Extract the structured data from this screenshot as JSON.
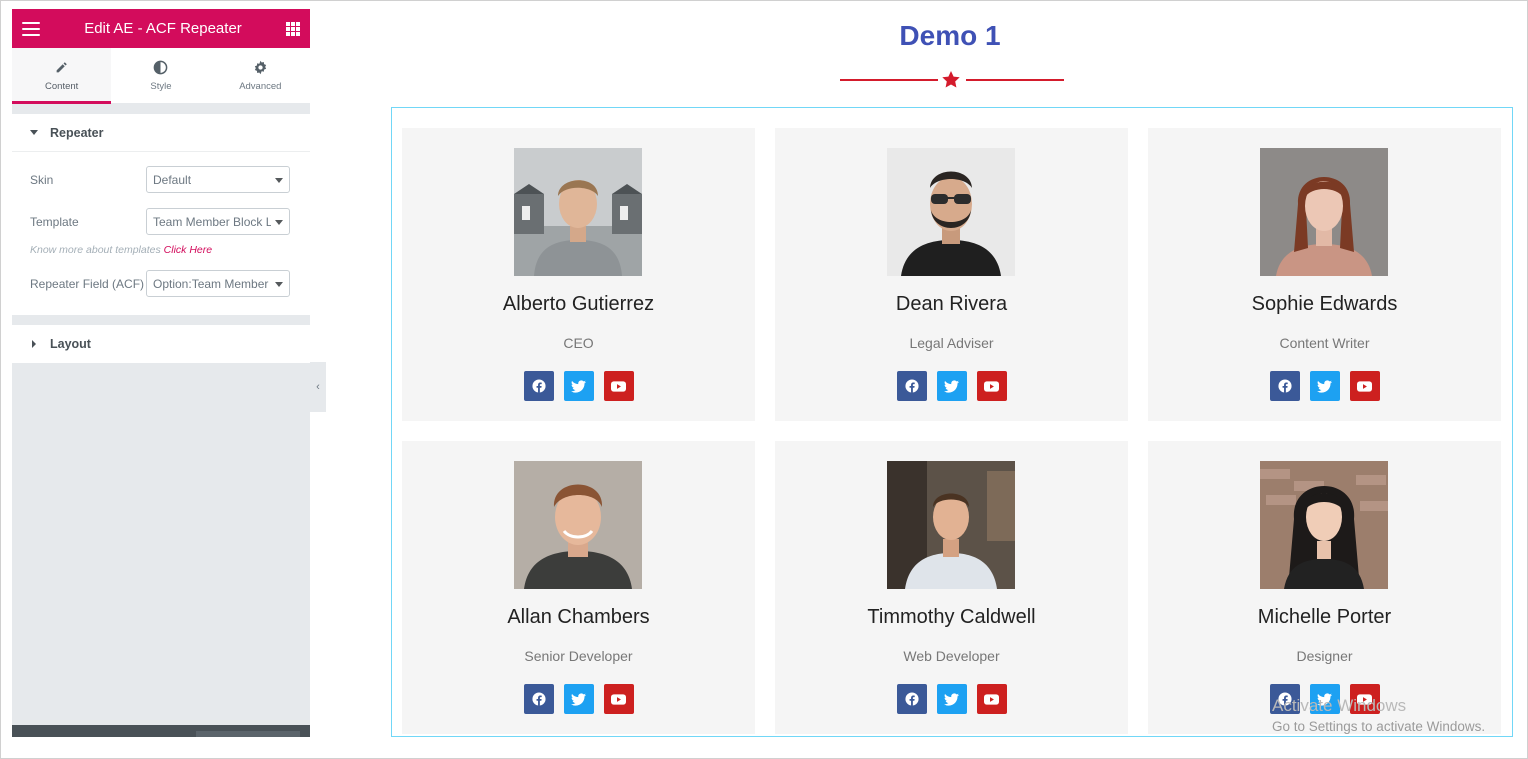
{
  "panel": {
    "title": "Edit AE - ACF Repeater",
    "tabs": [
      {
        "label": "Content",
        "icon": "pencil-icon"
      },
      {
        "label": "Style",
        "icon": "half-circle-icon"
      },
      {
        "label": "Advanced",
        "icon": "gear-icon"
      }
    ],
    "repeater_section": {
      "title": "Repeater",
      "skin_label": "Skin",
      "skin_value": "Default",
      "template_label": "Template",
      "template_value": "Team Member Block Layout",
      "note_text": "Know more about templates ",
      "note_link": "Click Here",
      "field_label": "Repeater Field (ACF)",
      "field_value": "Option:Team Member"
    },
    "layout_section": {
      "title": "Layout"
    },
    "accent_color": "#d30c5c"
  },
  "preview": {
    "title": "Demo 1",
    "title_color": "#3f51b5",
    "divider_color": "#d41b2c",
    "members": [
      {
        "name": "Alberto Gutierrez",
        "role": "CEO"
      },
      {
        "name": "Dean Rivera",
        "role": "Legal Adviser"
      },
      {
        "name": "Sophie Edwards",
        "role": "Content Writer"
      },
      {
        "name": "Allan Chambers",
        "role": "Senior Developer"
      },
      {
        "name": "Timmothy Caldwell",
        "role": "Web Developer"
      },
      {
        "name": "Michelle Porter",
        "role": "Designer"
      }
    ],
    "social_colors": {
      "facebook": "#3b5998",
      "twitter": "#1da1f2",
      "youtube": "#cd201f"
    }
  },
  "watermark": {
    "line1": "Activate Windows",
    "line2": "Go to Settings to activate Windows."
  }
}
